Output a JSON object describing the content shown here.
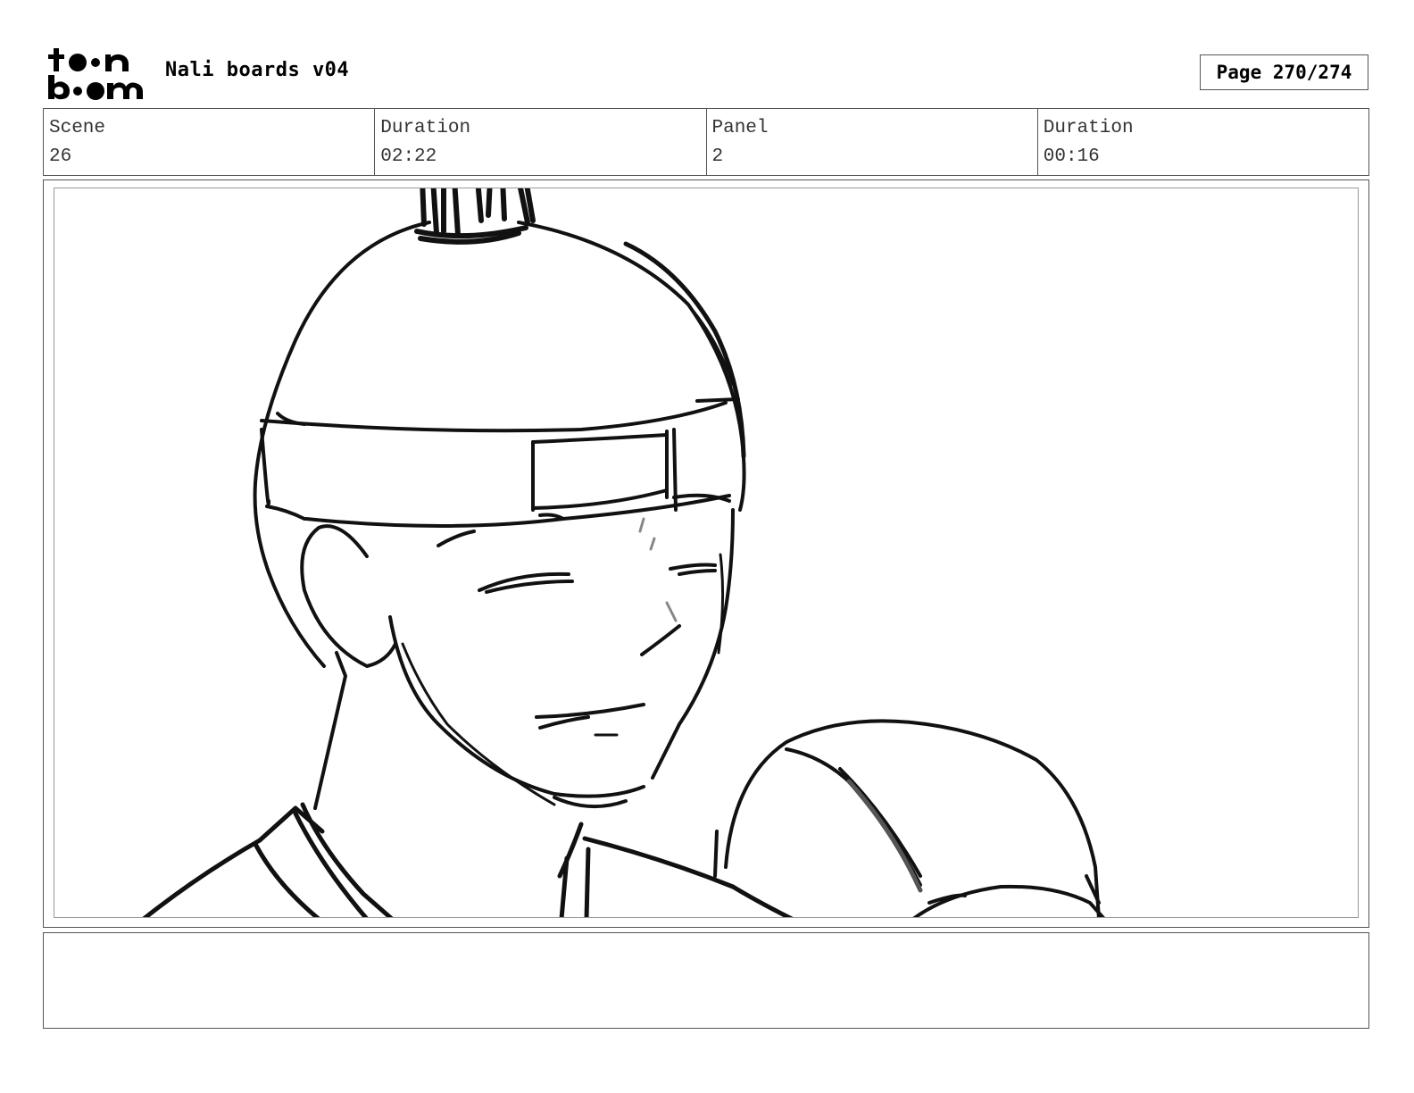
{
  "header": {
    "logo_icon": "toon-boom-logo",
    "doc_title": "Nali boards v04",
    "page_label": "Page 270/274"
  },
  "info": {
    "scene_label": "Scene",
    "scene_value": "26",
    "scene_duration_label": "Duration",
    "scene_duration_value": "02:22",
    "panel_label": "Panel",
    "panel_value": "2",
    "panel_duration_label": "Duration",
    "panel_duration_value": "00:16"
  },
  "panel": {
    "image": "storyboard-sketch"
  },
  "notes": {
    "text": ""
  }
}
